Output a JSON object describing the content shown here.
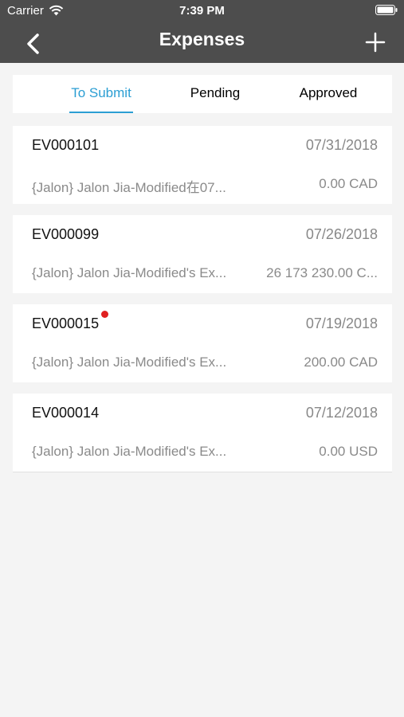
{
  "status_bar": {
    "carrier": "Carrier",
    "time": "7:39 PM"
  },
  "nav": {
    "title": "Expenses",
    "back_icon": "chevron-left-icon",
    "add_icon": "plus-icon"
  },
  "tabs": [
    {
      "label": "To Submit",
      "active": true
    },
    {
      "label": "Pending",
      "active": false
    },
    {
      "label": "Approved",
      "active": false
    }
  ],
  "expenses": [
    {
      "id": "EV000101",
      "date": "07/31/2018",
      "description": "{Jalon} Jalon Jia-Modified在07...",
      "amount": "0.00 CAD",
      "unread": false
    },
    {
      "id": "EV000099",
      "date": "07/26/2018",
      "description": "{Jalon} Jalon Jia-Modified's Ex...",
      "amount": "26 173 230.00 C...",
      "unread": false
    },
    {
      "id": "EV000015",
      "date": "07/19/2018",
      "description": "{Jalon} Jalon Jia-Modified's Ex...",
      "amount": "200.00 CAD",
      "unread": true
    },
    {
      "id": "EV000014",
      "date": "07/12/2018",
      "description": "{Jalon} Jalon Jia-Modified's Ex...",
      "amount": "0.00 USD",
      "unread": false
    }
  ],
  "colors": {
    "nav_bg": "#4d4d4d",
    "accent": "#2b9ed3",
    "badge": "#e02020",
    "page_bg": "#f4f4f4"
  }
}
